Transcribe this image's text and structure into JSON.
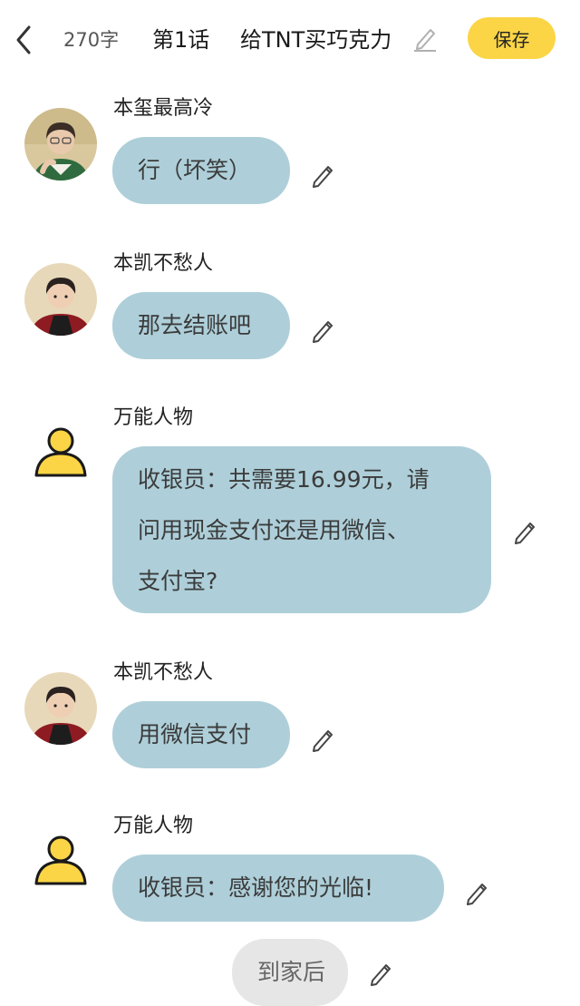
{
  "header": {
    "back_icon": "chevron-left-icon",
    "word_count": "270字",
    "chapter": "第1话",
    "title": "给TNT买巧克力",
    "edit_icon": "pencil-icon",
    "save_label": "保存",
    "accent": "#fbd546"
  },
  "bubble_color": "#aecfd9",
  "messages": [
    {
      "name": "本玺最高冷",
      "text": "行（坏笑）",
      "avatar": "photo-avatar"
    },
    {
      "name": "本凯不愁人",
      "text": "那去结账吧",
      "avatar": "photo-avatar"
    },
    {
      "name": "万能人物",
      "line1": "收银员：共需要16.99元，请",
      "line2": "问用现金支付还是用微信、",
      "line3": "支付宝?",
      "avatar": "generic-person-icon"
    },
    {
      "name": "本凯不愁人",
      "text": "用微信支付",
      "avatar": "photo-avatar"
    },
    {
      "name": "万能人物",
      "text": "收银员：感谢您的光临!",
      "avatar": "generic-person-icon"
    }
  ],
  "narration": {
    "text": "到家后"
  }
}
